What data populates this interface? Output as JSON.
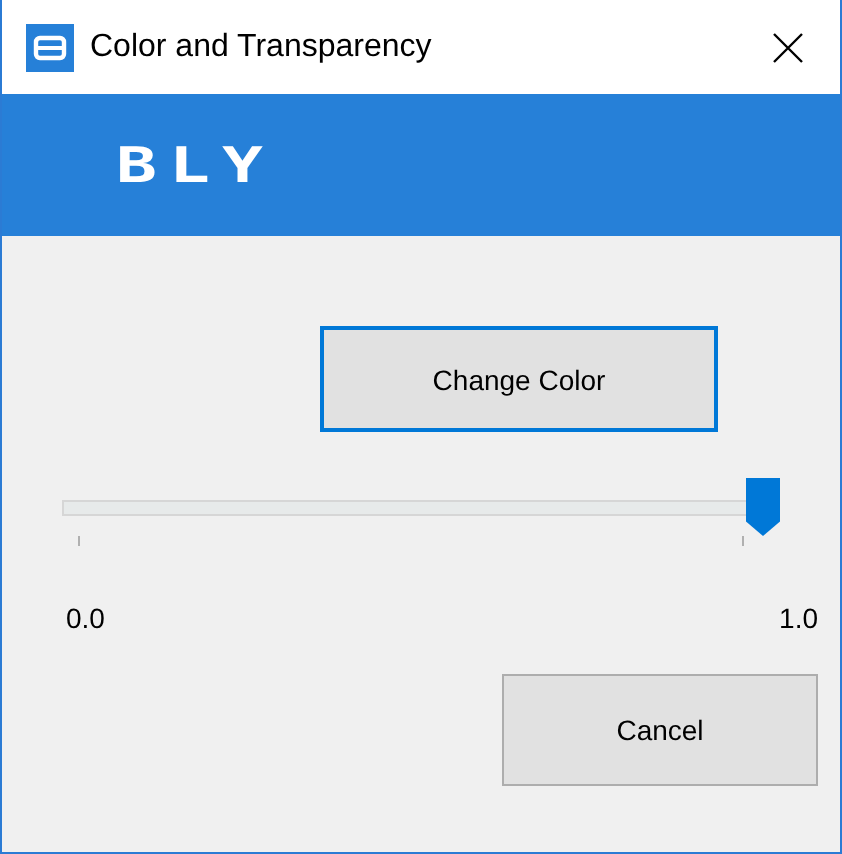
{
  "window": {
    "title": "Color and Transparency"
  },
  "banner": {
    "logo": "BLY"
  },
  "change_color_button": {
    "label": "Change Color",
    "focused": true
  },
  "slider": {
    "level": 1.0,
    "min_label": "0.0",
    "max_label": "1.0"
  },
  "cancel_button": {
    "label": "Cancel",
    "focused": false
  }
}
